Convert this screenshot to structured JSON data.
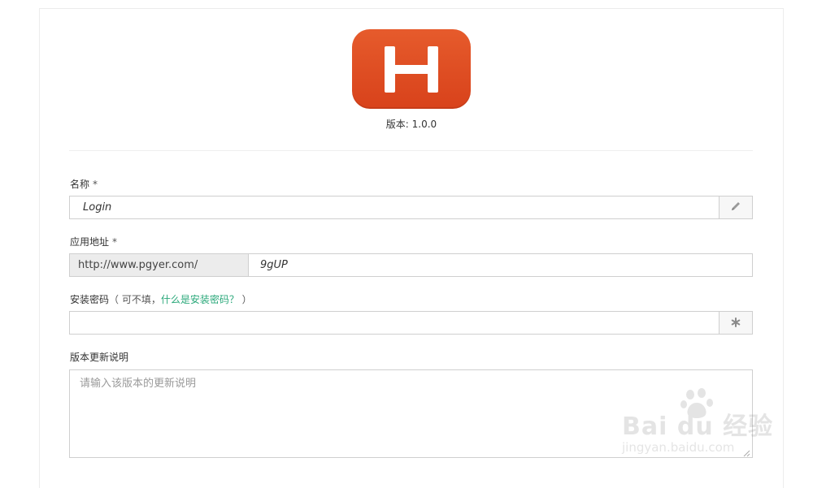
{
  "header": {
    "version_text": "版本: 1.0.0"
  },
  "form": {
    "name": {
      "label": "名称",
      "required_mark": "*",
      "value": "Login"
    },
    "app_url": {
      "label": "应用地址",
      "required_mark": "*",
      "prefix": "http://www.pgyer.com/",
      "value": "9gUP"
    },
    "install_password": {
      "label": "安装密码",
      "hint_open": "（ 可不填，",
      "hint_link": "什么是安装密码？",
      "hint_close": " ）",
      "value": ""
    },
    "release_notes": {
      "label": "版本更新说明",
      "placeholder": "请输入该版本的更新说明",
      "value": ""
    }
  },
  "icons": {
    "app_icon": "app-icon-letter-h",
    "name_addon": "pencil-icon",
    "password_addon": "asterisk-icon",
    "resize": "resize-grip-icon"
  },
  "colors": {
    "accent": "#2aa87a",
    "app_icon": "#e04f24"
  }
}
